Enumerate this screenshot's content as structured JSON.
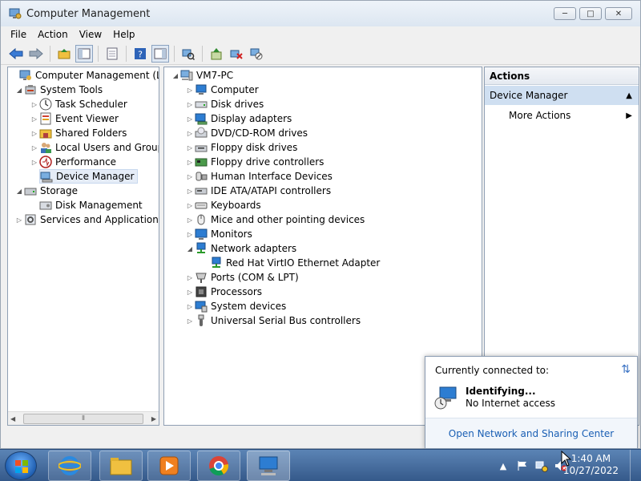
{
  "window": {
    "title": "Computer Management",
    "controls": {
      "minimize": "─",
      "maximize": "□",
      "close": "✕"
    }
  },
  "menu": [
    "File",
    "Action",
    "View",
    "Help"
  ],
  "left_tree": [
    {
      "label": "Computer Management (Local",
      "level": 0,
      "arrow": "",
      "icon": "computer-management-icon"
    },
    {
      "label": "System Tools",
      "level": 1,
      "arrow": "◢",
      "icon": "system-tools-icon"
    },
    {
      "label": "Task Scheduler",
      "level": 2,
      "arrow": "▷",
      "icon": "clock-icon"
    },
    {
      "label": "Event Viewer",
      "level": 2,
      "arrow": "▷",
      "icon": "event-viewer-icon"
    },
    {
      "label": "Shared Folders",
      "level": 2,
      "arrow": "▷",
      "icon": "shared-folder-icon"
    },
    {
      "label": "Local Users and Groups",
      "level": 2,
      "arrow": "▷",
      "icon": "users-icon"
    },
    {
      "label": "Performance",
      "level": 2,
      "arrow": "▷",
      "icon": "performance-icon"
    },
    {
      "label": "Device Manager",
      "level": 2,
      "arrow": "",
      "icon": "device-manager-icon",
      "selected": true
    },
    {
      "label": "Storage",
      "level": 1,
      "arrow": "◢",
      "icon": "storage-icon"
    },
    {
      "label": "Disk Management",
      "level": 2,
      "arrow": "",
      "icon": "disk-icon"
    },
    {
      "label": "Services and Applications",
      "level": 1,
      "arrow": "▷",
      "icon": "services-icon"
    }
  ],
  "device_tree": {
    "root": "VM7-PC",
    "items": [
      {
        "label": "Computer",
        "arrow": "▷",
        "icon": "computer-icon"
      },
      {
        "label": "Disk drives",
        "arrow": "▷",
        "icon": "disk-drive-icon"
      },
      {
        "label": "Display adapters",
        "arrow": "▷",
        "icon": "display-adapter-icon"
      },
      {
        "label": "DVD/CD-ROM drives",
        "arrow": "▷",
        "icon": "dvd-icon"
      },
      {
        "label": "Floppy disk drives",
        "arrow": "▷",
        "icon": "floppy-icon"
      },
      {
        "label": "Floppy drive controllers",
        "arrow": "▷",
        "icon": "floppy-controller-icon"
      },
      {
        "label": "Human Interface Devices",
        "arrow": "▷",
        "icon": "hid-icon"
      },
      {
        "label": "IDE ATA/ATAPI controllers",
        "arrow": "▷",
        "icon": "ide-controller-icon"
      },
      {
        "label": "Keyboards",
        "arrow": "▷",
        "icon": "keyboard-icon"
      },
      {
        "label": "Mice and other pointing devices",
        "arrow": "▷",
        "icon": "mouse-icon"
      },
      {
        "label": "Monitors",
        "arrow": "▷",
        "icon": "monitor-icon"
      },
      {
        "label": "Network adapters",
        "arrow": "◢",
        "icon": "network-adapter-icon"
      },
      {
        "label": "Red Hat VirtIO Ethernet Adapter",
        "arrow": "",
        "icon": "ethernet-adapter-icon",
        "child": true
      },
      {
        "label": "Ports (COM & LPT)",
        "arrow": "▷",
        "icon": "port-icon"
      },
      {
        "label": "Processors",
        "arrow": "▷",
        "icon": "processor-icon"
      },
      {
        "label": "System devices",
        "arrow": "▷",
        "icon": "system-device-icon"
      },
      {
        "label": "Universal Serial Bus controllers",
        "arrow": "▷",
        "icon": "usb-icon"
      }
    ]
  },
  "actions": {
    "title": "Actions",
    "section": "Device Manager",
    "more": "More Actions"
  },
  "network_popup": {
    "heading": "Currently connected to:",
    "network_name": "Identifying...",
    "status": "No Internet access",
    "link": "Open Network and Sharing Center"
  },
  "taskbar": {
    "time": "1:40 AM",
    "date": "10/27/2022"
  },
  "colors": {
    "selection": "#cfdff1",
    "taskbar": "#35598a",
    "link": "#1a5fb4"
  }
}
